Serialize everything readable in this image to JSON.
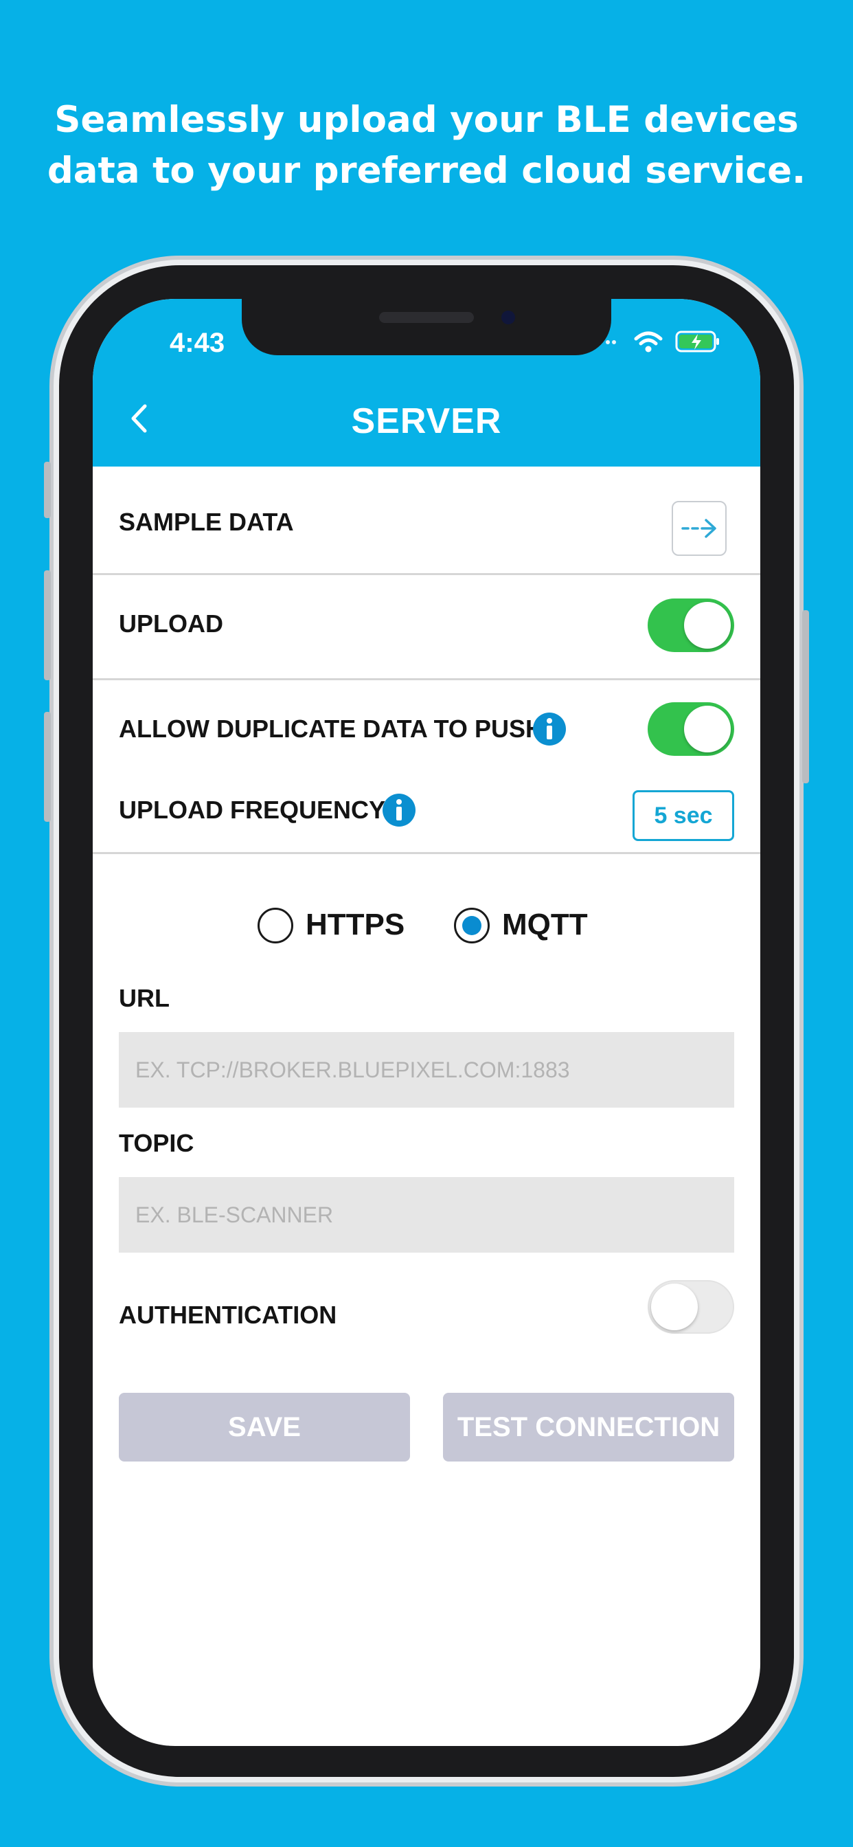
{
  "headline": {
    "line1": "Seamlessly upload your BLE devices",
    "line2": "data to your preferred cloud service."
  },
  "status_bar": {
    "time": "4:43",
    "icons": [
      "signal-dots-icon",
      "wifi-icon",
      "battery-charging-icon"
    ]
  },
  "header": {
    "title": "SERVER",
    "back_icon": "chevron-left-icon"
  },
  "settings": {
    "sample_data_label": "SAMPLE DATA",
    "upload_label": "UPLOAD",
    "upload_enabled": true,
    "allow_duplicate_label": "ALLOW DUPLICATE DATA TO PUSH",
    "allow_duplicate_enabled": true,
    "upload_frequency_label": "UPLOAD FREQUENCY",
    "upload_frequency_value": "5 sec"
  },
  "protocol": {
    "options": [
      {
        "label": "HTTPS",
        "selected": false
      },
      {
        "label": "MQTT",
        "selected": true
      }
    ]
  },
  "form": {
    "url_label": "URL",
    "url_value": "",
    "url_placeholder": "EX. TCP://BROKER.BLUEPIXEL.COM:1883",
    "topic_label": "TOPIC",
    "topic_value": "",
    "topic_placeholder": "EX. BLE-SCANNER",
    "authentication_label": "AUTHENTICATION",
    "authentication_enabled": false
  },
  "actions": {
    "save_label": "SAVE",
    "test_connection_label": "TEST CONNECTION"
  },
  "colors": {
    "background": "#06b1e7",
    "app_bar": "#07b2e7",
    "toggle_on": "#33c24d",
    "accent_blue": "#14a6d4",
    "button_disabled": "#c6c7d6"
  }
}
